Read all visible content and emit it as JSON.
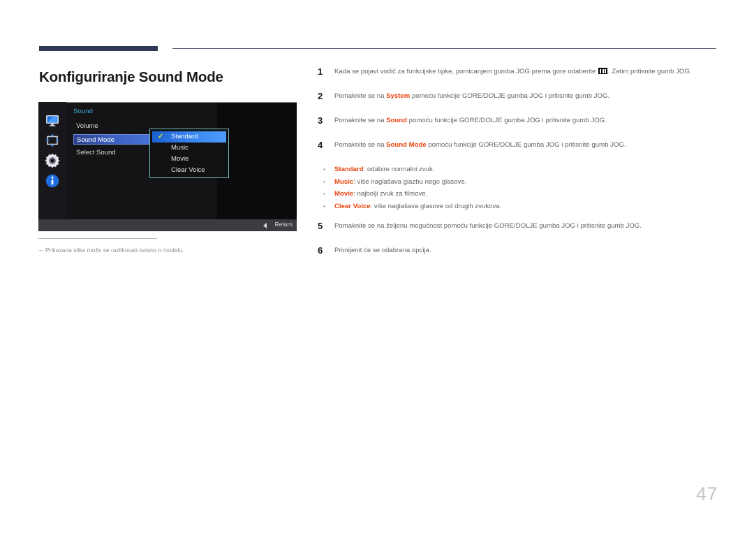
{
  "page": {
    "title": "Konfiguriranje Sound Mode",
    "number": "47",
    "accent_navy": "#2e3755",
    "accent_keyword": "#e8430f"
  },
  "osd": {
    "menu_title": "Sound",
    "sidebar_icons": [
      "display-icon",
      "resize-icon",
      "gear-icon",
      "info-icon"
    ],
    "items": [
      {
        "label": "Volume",
        "selected": false
      },
      {
        "label": "Sound Mode",
        "selected": true
      },
      {
        "label": "Select Sound",
        "selected": false
      }
    ],
    "dropdown": {
      "options": [
        {
          "label": "Standard",
          "checked": true
        },
        {
          "label": "Music",
          "checked": false
        },
        {
          "label": "Movie",
          "checked": false
        },
        {
          "label": "Clear Voice",
          "checked": false
        }
      ],
      "check_glyph": "✓"
    },
    "return_label": "Return",
    "title_color": "#3fb6e0",
    "highlight_color": "#3f63c4"
  },
  "caption": {
    "dash": "–",
    "text": "Prikazana slika može se razlikovati ovisno o modelu."
  },
  "steps": [
    {
      "number": "1",
      "text_before": "Kada se pojavi vodič za funkcijske tipke, pomicanjem gumba JOG prema gore odaberite",
      "glyph": "menu-icon",
      "text_after": ". Zatim pritisnite gumb JOG."
    },
    {
      "number": "2",
      "text_before": "Pomaknite se na ",
      "keyword": "System",
      "text_after": " pomoću funkcije GORE/DOLJE gumba JOG i pritisnite gumb JOG."
    },
    {
      "number": "3",
      "text_before": "Pomaknite se na ",
      "keyword": "Sound",
      "text_after": " pomoću funkcije GORE/DOLJE gumba JOG i pritisnite gumb JOG."
    },
    {
      "number": "4",
      "text_before": "Pomaknite se na ",
      "keyword": "Sound Mode",
      "text_after": " pomoću funkcije GORE/DOLJE gumba JOG i pritisnite gumb JOG."
    },
    {
      "number": "5",
      "text_before": "Pomaknite se na željenu mogućnost pomoću funkcije GORE/DOLJE gumba JOG i pritisnite gumb JOG."
    },
    {
      "number": "6",
      "text_before": "Primijenit će se odabrana opcija."
    }
  ],
  "bullets": [
    {
      "keyword": "Standard",
      "text": ": odabire normalni zvuk."
    },
    {
      "keyword": "Music",
      "text": ": više naglašava glazbu nego glasove."
    },
    {
      "keyword": "Movie",
      "text": ": najbolji zvuk za filmove."
    },
    {
      "keyword": "Clear Voice",
      "text": ": više naglašava glasove od drugih zvukova."
    }
  ]
}
